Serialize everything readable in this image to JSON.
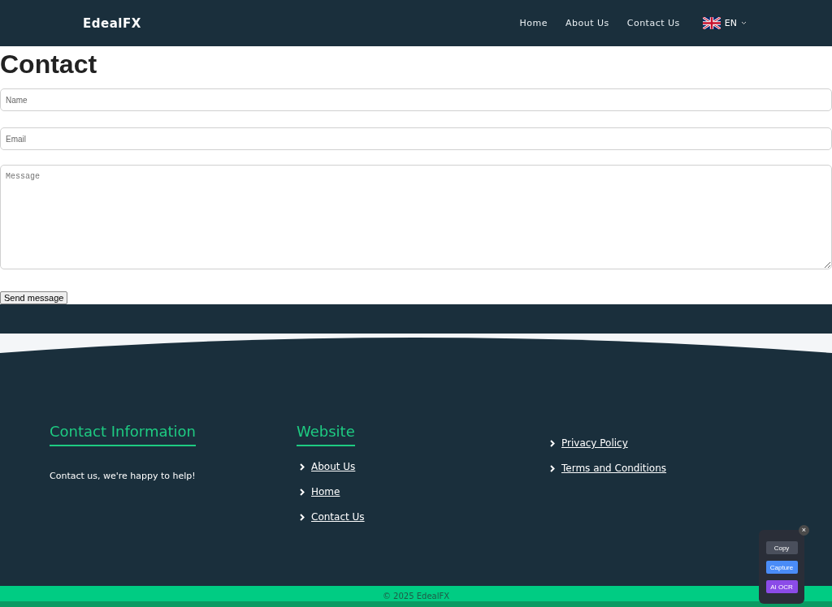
{
  "nav": {
    "brand": "EdealFX",
    "links": [
      {
        "label": "Home"
      },
      {
        "label": "About Us"
      },
      {
        "label": "Contact Us"
      }
    ],
    "language": "EN"
  },
  "page_title": "Contact",
  "form": {
    "fields": [
      {
        "kind": "input",
        "placeholder": "Name"
      },
      {
        "kind": "input",
        "placeholder": "Email"
      },
      {
        "kind": "textarea",
        "placeholder": "Message"
      }
    ],
    "submit": "Send message"
  },
  "footer": {
    "columns": [
      {
        "heading": "Contact Information",
        "text": "Contact us, we're happy to help!"
      },
      {
        "heading": "Website",
        "links": [
          "About Us",
          "Home",
          "Contact Us"
        ]
      },
      {
        "links": [
          "Privacy Policy",
          "Terms and Conditions"
        ]
      }
    ],
    "copyright": "© 2025 EdealFX"
  },
  "overlay": {
    "close": "×",
    "buttons": [
      {
        "label": "Copy",
        "color": "#4a4f5c"
      },
      {
        "label": "Capture",
        "color": "#4a8cf7"
      },
      {
        "label": "AI OCR",
        "color": "#8b4be8"
      }
    ]
  }
}
